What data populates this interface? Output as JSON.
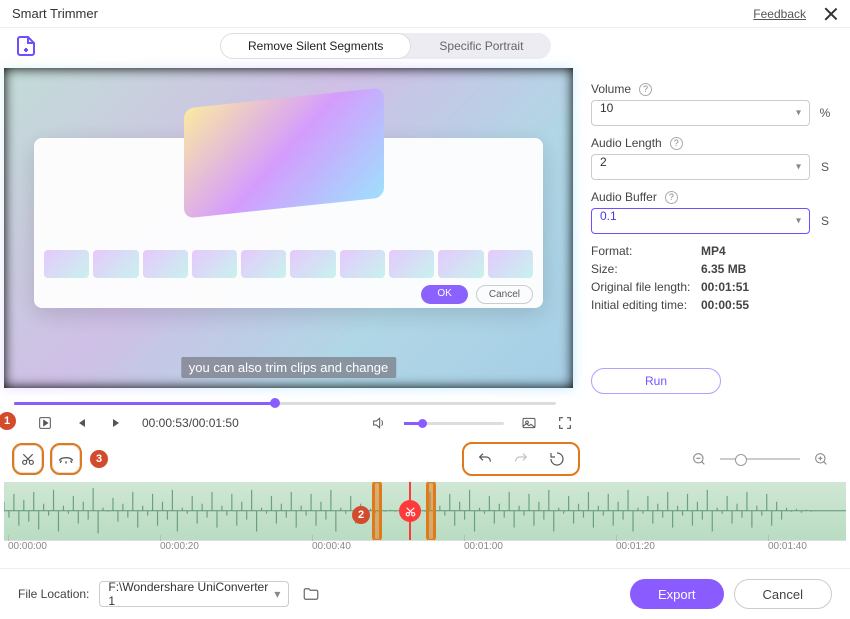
{
  "window": {
    "title": "Smart Trimmer",
    "feedback": "Feedback"
  },
  "tabs": {
    "remove_silent": "Remove Silent Segments",
    "specific_portrait": "Specific Portrait"
  },
  "preview": {
    "caption": "you can also trim clips and change",
    "ok": "OK",
    "cancel": "Cancel"
  },
  "transport": {
    "current": "00:00:53",
    "total": "00:01:50"
  },
  "side": {
    "volume_label": "Volume",
    "volume_value": "10",
    "volume_unit": "%",
    "audio_length_label": "Audio Length",
    "audio_length_value": "2",
    "audio_length_unit": "S",
    "audio_buffer_label": "Audio Buffer",
    "audio_buffer_value": "0.1",
    "audio_buffer_unit": "S",
    "format_label": "Format:",
    "format_value": "MP4",
    "size_label": "Size:",
    "size_value": "6.35 MB",
    "orig_len_label": "Original file length:",
    "orig_len_value": "00:01:51",
    "init_time_label": "Initial editing time:",
    "init_time_value": "00:00:55",
    "run": "Run"
  },
  "callouts": {
    "one": "1",
    "two": "2",
    "three": "3"
  },
  "ruler": {
    "t0": "00:00:00",
    "t1": "00:00:20",
    "t2": "00:00:40",
    "t3": "00:01:00",
    "t4": "00:01:20",
    "t5": "00:01:40"
  },
  "footer": {
    "location_label": "File Location:",
    "path": "F:\\Wondershare UniConverter 1",
    "export": "Export",
    "cancel": "Cancel"
  }
}
